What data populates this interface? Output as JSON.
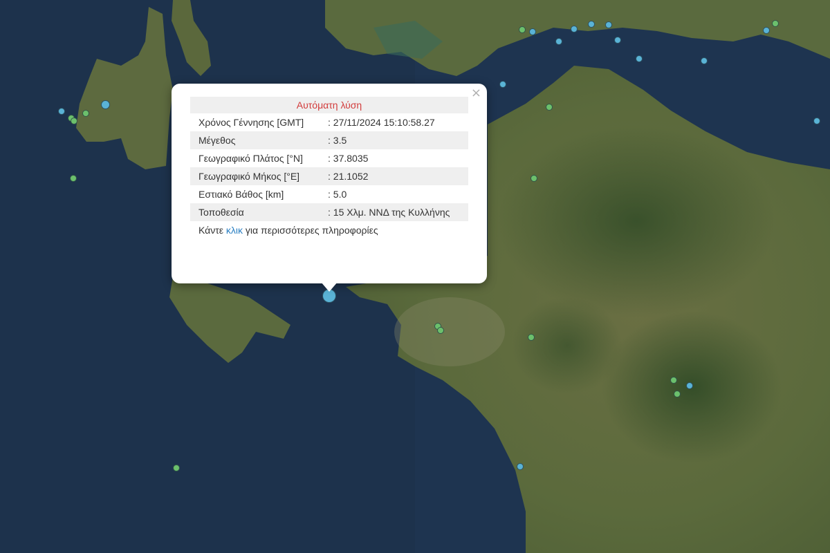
{
  "map": {
    "markers": [
      {
        "lat": 37.8035,
        "lon": 21.1052,
        "magnitude": 3.5,
        "color": "#5ab3d6",
        "selected": true
      },
      {
        "color": "#5ab3d6",
        "magnitude": 3.3
      },
      {
        "color": "#5ab3d6",
        "magnitude": 2.7
      },
      {
        "color": "#5ab3d6",
        "magnitude": 2.7
      },
      {
        "color": "#5ab3d6",
        "magnitude": 2.7
      },
      {
        "color": "#5ab3d6",
        "magnitude": 2.7
      },
      {
        "color": "#5ab3d6",
        "magnitude": 2.7
      },
      {
        "color": "#5ab3d6",
        "magnitude": 2.7
      },
      {
        "color": "#5ab3d6",
        "magnitude": 2.7
      },
      {
        "color": "#5ab3d6",
        "magnitude": 2.7
      },
      {
        "color": "#5ab3d6",
        "magnitude": 2.7
      },
      {
        "color": "#5ab3d6",
        "magnitude": 2.7
      },
      {
        "color": "#5ab3d6",
        "magnitude": 2.7
      },
      {
        "color": "#5ab3d6",
        "magnitude": 2.7
      },
      {
        "color": "#5ab3d6",
        "magnitude": 2.7
      },
      {
        "color": "#5ab3d6",
        "magnitude": 2.7
      },
      {
        "color": "#6cc06c",
        "magnitude": 3.0
      },
      {
        "color": "#6cc06c",
        "magnitude": 2.8
      },
      {
        "color": "#6cc06c",
        "magnitude": 2.6
      },
      {
        "color": "#6cc06c",
        "magnitude": 2.6
      },
      {
        "color": "#6cc06c",
        "magnitude": 2.6
      },
      {
        "color": "#6cc06c",
        "magnitude": 2.6
      },
      {
        "color": "#6cc06c",
        "magnitude": 2.6
      },
      {
        "color": "#6cc06c",
        "magnitude": 2.6
      },
      {
        "color": "#6cc06c",
        "magnitude": 2.6
      },
      {
        "color": "#6cc06c",
        "magnitude": 2.6
      },
      {
        "color": "#6cc06c",
        "magnitude": 2.6
      },
      {
        "color": "#6cc06c",
        "magnitude": 2.6
      },
      {
        "color": "#6cc06c",
        "magnitude": 2.6
      },
      {
        "color": "#6cc06c",
        "magnitude": 2.6
      }
    ]
  },
  "popup": {
    "close": "×",
    "title": "Αυτόματη λύση",
    "rows": [
      {
        "label": "Χρόνος Γέννησης [GMT]",
        "value": ": 27/11/2024 15:10:58.27"
      },
      {
        "label": "Μέγεθος",
        "value": ": 3.5"
      },
      {
        "label": "Γεωγραφικό Πλάτος [°N]",
        "value": ": 37.8035"
      },
      {
        "label": "Γεωγραφικό Μήκος [°E]",
        "value": ": 21.1052"
      },
      {
        "label": "Εστιακό Βάθος [km]",
        "value": ": 5.0"
      },
      {
        "label": "Τοποθεσία",
        "value": ": 15 Χλμ. ΝΝΔ της Κυλλήνης"
      }
    ],
    "more_prefix": "Κάντε ",
    "more_link": "κλικ",
    "more_suffix": " για περισσότερες πληροφορίες"
  },
  "colors": {
    "sea": "#1f3552",
    "land": "#5f6b3f",
    "popup_title": "#d23b3b",
    "link": "#2a7fc2"
  }
}
